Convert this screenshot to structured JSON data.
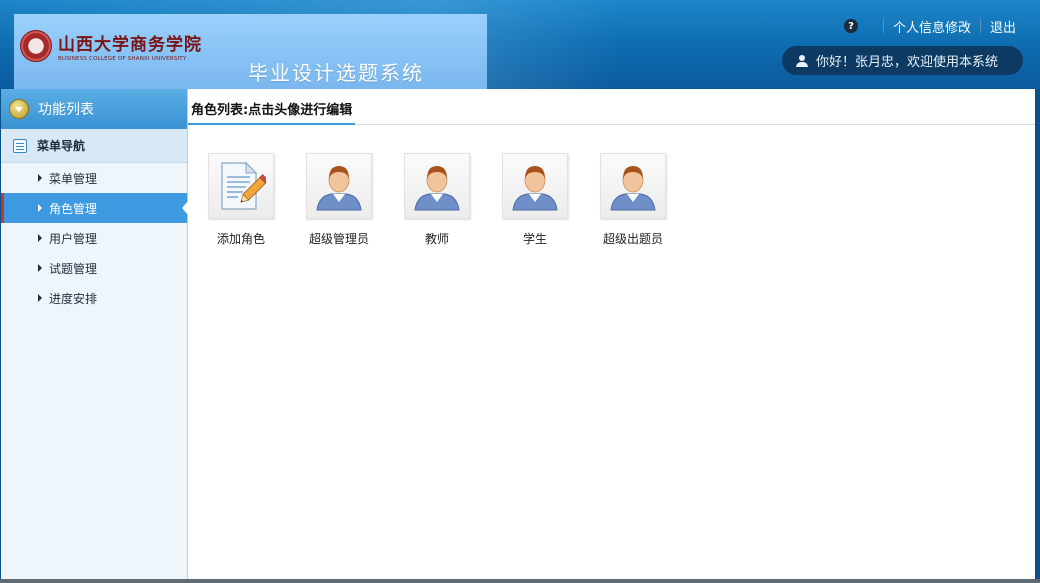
{
  "header": {
    "logo_cn": "山西大学商务学院",
    "logo_en": "BUSINESS COLLEGE OF SHANXI UNIVERSITY",
    "seal_text": "商",
    "system_title": "毕业设计选题系统",
    "help_icon": "?",
    "profile_link": "个人信息修改",
    "logout_link": "退出",
    "welcome": "你好！张月忠，欢迎使用本系统"
  },
  "sidebar": {
    "title": "功能列表",
    "group": "菜单导航",
    "items": [
      {
        "label": "菜单管理",
        "active": false
      },
      {
        "label": "角色管理",
        "active": true
      },
      {
        "label": "用户管理",
        "active": false
      },
      {
        "label": "试题管理",
        "active": false
      },
      {
        "label": "进度安排",
        "active": false
      }
    ]
  },
  "main": {
    "tab_label": "角色列表:点击头像进行编辑",
    "roles": [
      {
        "label": "添加角色",
        "icon": "notepad-pencil-icon"
      },
      {
        "label": "超级管理员",
        "icon": "user-avatar-icon"
      },
      {
        "label": "教师",
        "icon": "user-avatar-icon"
      },
      {
        "label": "学生",
        "icon": "user-avatar-icon"
      },
      {
        "label": "超级出题员",
        "icon": "user-avatar-icon"
      }
    ]
  },
  "colors": {
    "header_bg": "#0f6fb2",
    "banner_bg": "#86c2f5",
    "active_item": "#3d9ae0",
    "active_marker": "#c0392b",
    "sidebar_bg": "#eef5fb"
  }
}
